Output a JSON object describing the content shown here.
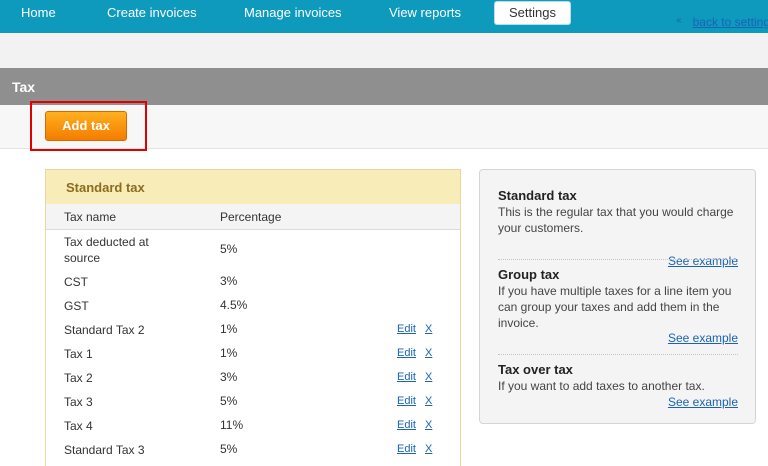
{
  "nav": {
    "items": [
      "Home",
      "Create invoices",
      "Manage invoices",
      "View reports",
      "Settings"
    ],
    "active": "Settings"
  },
  "back": {
    "arrow": "«",
    "label": "back to settings"
  },
  "section": {
    "title": "Tax"
  },
  "actions": {
    "add_tax": "Add tax"
  },
  "standard_panel": {
    "title": "Standard tax",
    "columns": {
      "name": "Tax name",
      "percentage": "Percentage"
    },
    "rows": [
      {
        "name": "Tax deducted at source",
        "pct": "5%",
        "edit": "",
        "del": ""
      },
      {
        "name": "CST",
        "pct": "3%",
        "edit": "",
        "del": ""
      },
      {
        "name": "GST",
        "pct": "4.5%",
        "edit": "",
        "del": ""
      },
      {
        "name": "Standard Tax 2",
        "pct": "1%",
        "edit": "Edit",
        "del": "X"
      },
      {
        "name": "Tax 1",
        "pct": "1%",
        "edit": "Edit",
        "del": "X"
      },
      {
        "name": "Tax 2",
        "pct": "3%",
        "edit": "Edit",
        "del": "X"
      },
      {
        "name": "Tax 3",
        "pct": "5%",
        "edit": "Edit",
        "del": "X"
      },
      {
        "name": "Tax 4",
        "pct": "11%",
        "edit": "Edit",
        "del": "X"
      },
      {
        "name": "Standard Tax 3",
        "pct": "5%",
        "edit": "Edit",
        "del": "X"
      }
    ]
  },
  "help": {
    "standard": {
      "title": "Standard tax",
      "text": "This is the regular tax that you would charge your customers.",
      "link": "See example"
    },
    "group": {
      "title": "Group tax",
      "text": "If you have multiple taxes for a line item you can group your taxes and add them in the invoice.",
      "link": "See example"
    },
    "over": {
      "title": "Tax over tax",
      "text": "If you want to add taxes to another tax.",
      "link": "See example"
    }
  }
}
